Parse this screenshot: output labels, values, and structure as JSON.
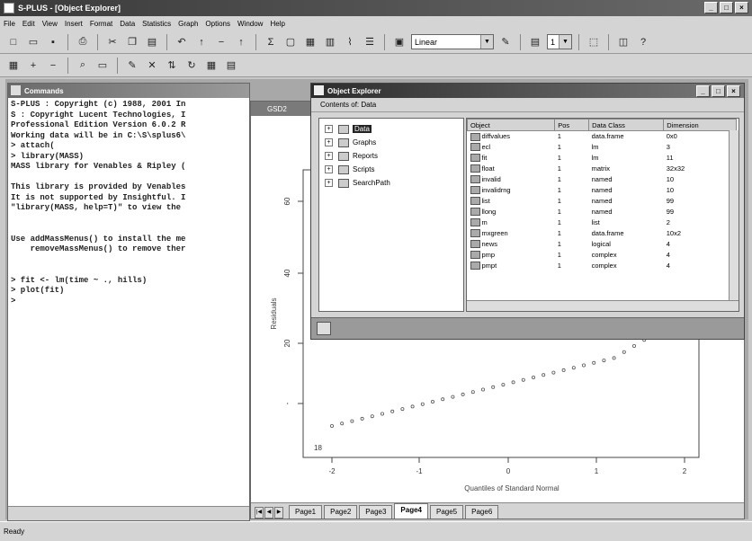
{
  "app": {
    "title": "S-PLUS - [Object Explorer]"
  },
  "menu": [
    "File",
    "Edit",
    "View",
    "Insert",
    "Format",
    "Data",
    "Statistics",
    "Graph",
    "Options",
    "Window",
    "Help"
  ],
  "toolbar": {
    "plot_type": "Linear",
    "page_num": "1"
  },
  "commands": {
    "title": "Commands",
    "lines": [
      "S-PLUS : Copyright (c) 1988, 2001 In",
      "S : Copyright Lucent Technologies, I",
      "Professional Edition Version 6.0.2 R",
      "Working data will be in C:\\S\\splus6\\",
      "> attach(",
      "> library(MASS)",
      "MASS library for Venables & Ripley (",
      "",
      "This library is provided by Venables",
      "It is not supported by Insightful. I",
      "\"library(MASS, help=T)\" to view the",
      "",
      "",
      "Use addMassMenus() to install the me",
      "    removeMassMenus() to remove ther",
      "",
      "",
      "> fit <- lm(time ~ ., hills)",
      "> plot(fit)",
      ">"
    ]
  },
  "graph": {
    "title": "GSD2",
    "xlabel": "Quantiles of Standard Normal",
    "ylabel": "Residuals",
    "xticks": [
      "-2",
      "-1",
      "0",
      "1",
      "2"
    ],
    "yticks": [
      "-",
      "20",
      "40",
      "60"
    ],
    "point_label": "18",
    "pages": [
      "Page1",
      "Page2",
      "Page3",
      "Page4",
      "Page5",
      "Page6"
    ],
    "active_page": "Page4"
  },
  "object_explorer": {
    "title": "Object Explorer",
    "subtitle": "Contents of: Data",
    "tree": [
      {
        "label": "Data",
        "selected": true
      },
      {
        "label": "Graphs",
        "selected": false
      },
      {
        "label": "Reports",
        "selected": false
      },
      {
        "label": "Scripts",
        "selected": false
      },
      {
        "label": "SearchPath",
        "selected": false
      }
    ],
    "columns": [
      "Object",
      "Pos",
      "Data Class",
      "Dimension"
    ],
    "rows": [
      [
        "diffvalues",
        "1",
        "data.frame",
        "0x0"
      ],
      [
        "ecl",
        "1",
        "lm",
        "3"
      ],
      [
        "fit",
        "1",
        "lm",
        "11"
      ],
      [
        "float",
        "1",
        "matrix",
        "32x32"
      ],
      [
        "invalid",
        "1",
        "named",
        "10"
      ],
      [
        "invalidrng",
        "1",
        "named",
        "10"
      ],
      [
        "list",
        "1",
        "named",
        "99"
      ],
      [
        "llong",
        "1",
        "named",
        "99"
      ],
      [
        "m",
        "1",
        "list",
        "2"
      ],
      [
        "mxgreen",
        "1",
        "data.frame",
        "10x2"
      ],
      [
        "news",
        "1",
        "logical",
        "4"
      ],
      [
        "pmp",
        "1",
        "complex",
        "4"
      ],
      [
        "pmpt",
        "1",
        "complex",
        "4"
      ]
    ]
  },
  "status": {
    "text": "Ready"
  }
}
